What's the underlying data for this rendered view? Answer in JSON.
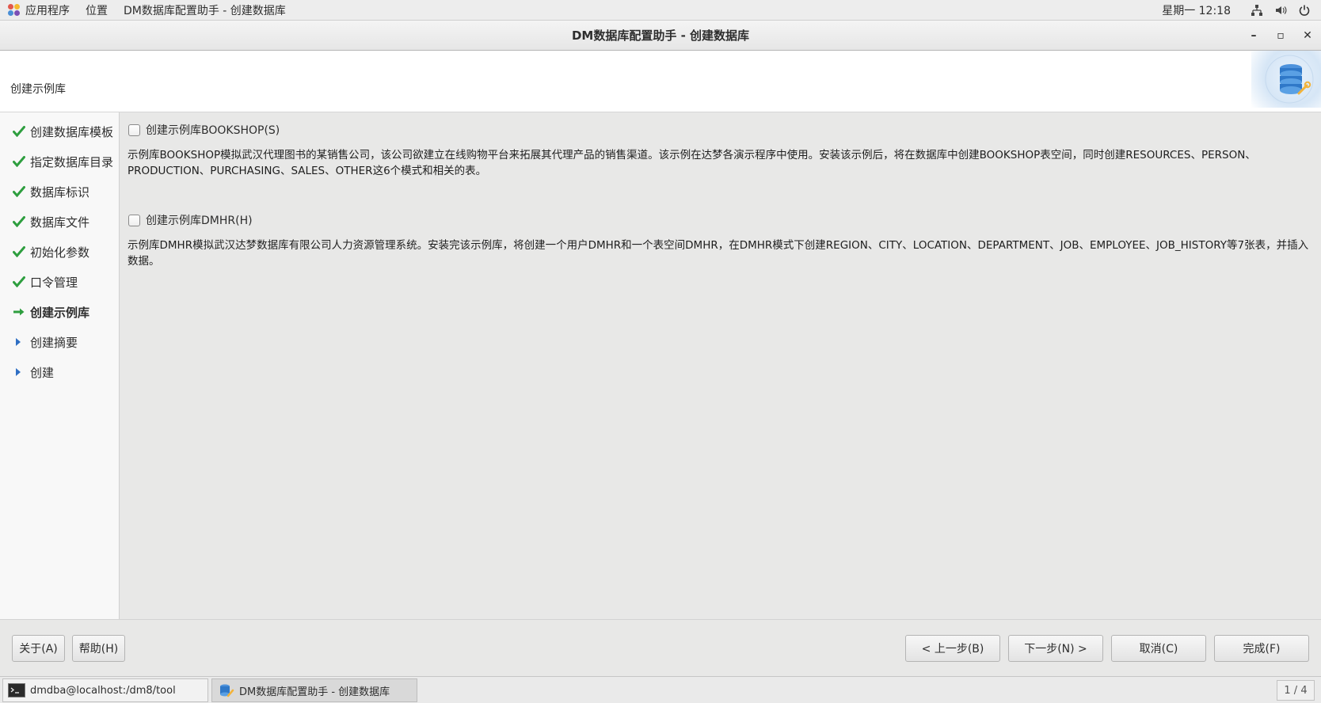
{
  "top_panel": {
    "apps_label": "应用程序",
    "places_label": "位置",
    "active_app_label": "DM数据库配置助手 - 创建数据库",
    "clock": "星期一 12:18",
    "icons": [
      "network-icon",
      "volume-icon",
      "power-icon"
    ]
  },
  "window": {
    "title": "DM数据库配置助手 - 创建数据库",
    "minimize_glyph": "–",
    "maximize_glyph": "▫",
    "close_glyph": "✕"
  },
  "header": {
    "title": "创建示例库",
    "logo_icon": "database-wrench-icon"
  },
  "sidebar": {
    "steps": [
      {
        "label": "创建数据库模板",
        "status": "done"
      },
      {
        "label": "指定数据库目录",
        "status": "done"
      },
      {
        "label": "数据库标识",
        "status": "done"
      },
      {
        "label": "数据库文件",
        "status": "done"
      },
      {
        "label": "初始化参数",
        "status": "done"
      },
      {
        "label": "口令管理",
        "status": "done"
      },
      {
        "label": "创建示例库",
        "status": "current"
      },
      {
        "label": "创建摘要",
        "status": "pending"
      },
      {
        "label": "创建",
        "status": "pending"
      }
    ]
  },
  "content": {
    "bookshop": {
      "label": "创建示例库BOOKSHOP(S)",
      "checked": false,
      "description": "示例库BOOKSHOP模拟武汉代理图书的某销售公司，该公司欲建立在线购物平台来拓展其代理产品的销售渠道。该示例在达梦各演示程序中使用。安装该示例后，将在数据库中创建BOOKSHOP表空间，同时创建RESOURCES、PERSON、PRODUCTION、PURCHASING、SALES、OTHER这6个模式和相关的表。"
    },
    "dmhr": {
      "label": "创建示例库DMHR(H)",
      "checked": false,
      "description": "示例库DMHR模拟武汉达梦数据库有限公司人力资源管理系统。安装完该示例库，将创建一个用户DMHR和一个表空间DMHR，在DMHR模式下创建REGION、CITY、LOCATION、DEPARTMENT、JOB、EMPLOYEE、JOB_HISTORY等7张表，并插入数据。"
    }
  },
  "buttons": {
    "about": "关于(A)",
    "help": "帮助(H)",
    "back": "< 上一步(B)",
    "next": "下一步(N) >",
    "cancel": "取消(C)",
    "finish": "完成(F)"
  },
  "taskbar": {
    "terminal": "dmdba@localhost:/dm8/tool",
    "app": "DM数据库配置助手 - 创建数据库",
    "workspace": "1 / 4"
  },
  "colors": {
    "check_green": "#2e9e3f",
    "arrow_green": "#2e9e3f",
    "pending_blue": "#2f6fc4"
  }
}
